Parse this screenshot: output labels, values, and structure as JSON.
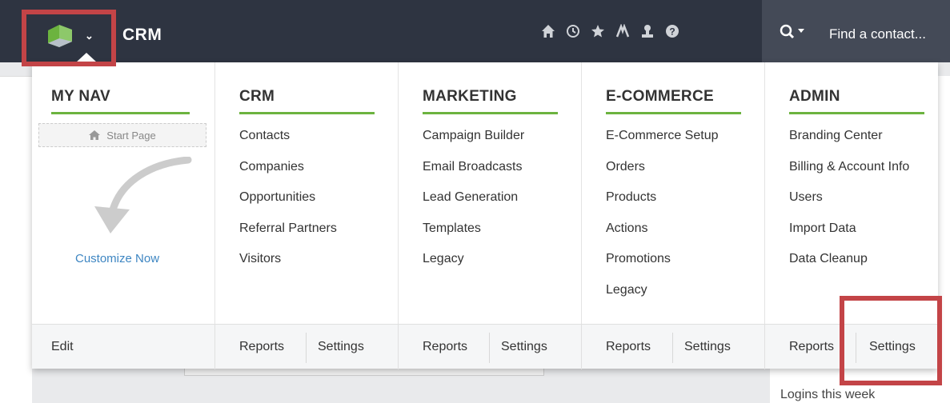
{
  "header": {
    "app_title": "CRM",
    "search_placeholder": "Find a contact...",
    "icons": [
      "home-icon",
      "recent-icon",
      "favorites-icon",
      "activity-icon",
      "user-icon",
      "help-icon"
    ]
  },
  "colors": {
    "accent_green": "#6cb33f",
    "topbar": "#2e3441",
    "highlight": "#c34447",
    "link_blue": "#3e86c2"
  },
  "menu": {
    "my_nav": {
      "heading": "MY NAV",
      "start_page": "Start Page",
      "customize": "Customize Now",
      "footer_edit": "Edit"
    },
    "columns": [
      {
        "heading": "CRM",
        "items": [
          "Contacts",
          "Companies",
          "Opportunities",
          "Referral Partners",
          "Visitors"
        ]
      },
      {
        "heading": "MARKETING",
        "items": [
          "Campaign Builder",
          "Email Broadcasts",
          "Lead Generation",
          "Templates",
          "Legacy"
        ]
      },
      {
        "heading": "E-COMMERCE",
        "items": [
          "E-Commerce Setup",
          "Orders",
          "Products",
          "Actions",
          "Promotions",
          "Legacy"
        ]
      },
      {
        "heading": "ADMIN",
        "items": [
          "Branding Center",
          "Billing & Account Info",
          "Users",
          "Import Data",
          "Data Cleanup"
        ]
      }
    ],
    "footer": {
      "reports": "Reports",
      "settings": "Settings"
    }
  },
  "background": {
    "logins_label": "Logins this week"
  }
}
